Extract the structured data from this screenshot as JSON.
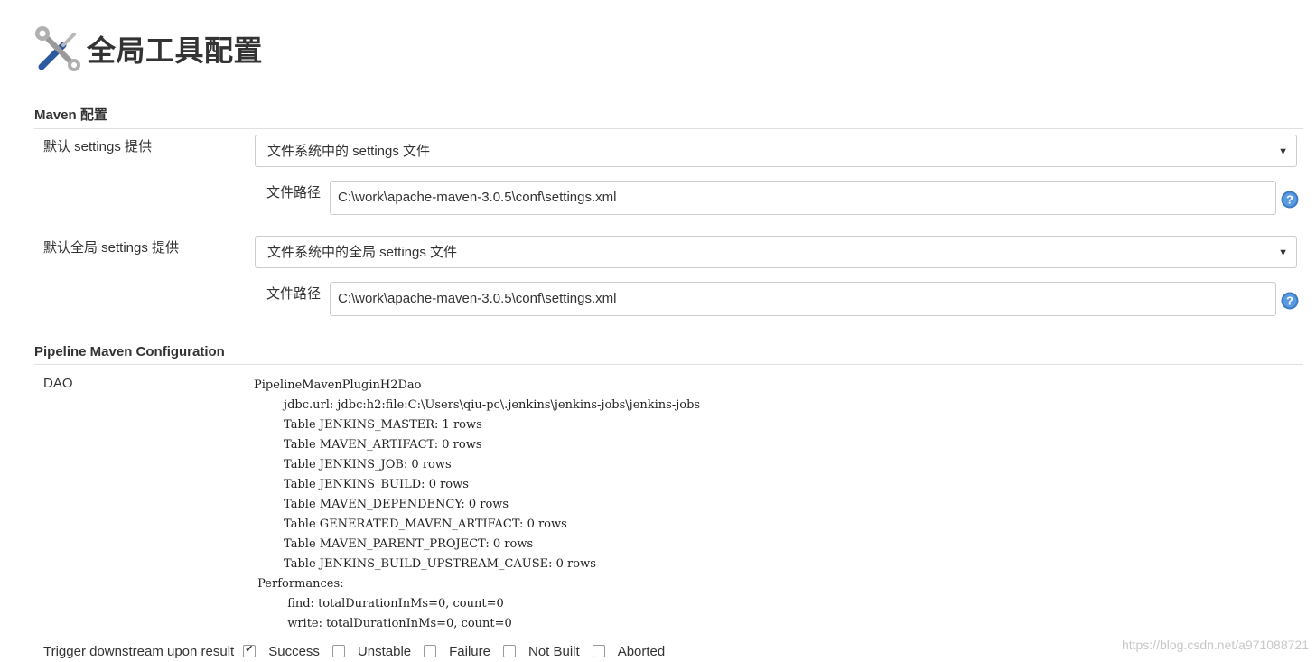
{
  "page": {
    "title": "全局工具配置",
    "icon": "tools-icon"
  },
  "maven_section": {
    "title": "Maven 配置",
    "settings": {
      "label": "默认 settings 提供",
      "selected": "文件系统中的 settings 文件",
      "path_label": "文件路径",
      "path_value": "C:\\work\\apache-maven-3.0.5\\conf\\settings.xml"
    },
    "global_settings": {
      "label": "默认全局 settings 提供",
      "selected": "文件系统中的全局 settings 文件",
      "path_label": "文件路径",
      "path_value": "C:\\work\\apache-maven-3.0.5\\conf\\settings.xml"
    }
  },
  "pipeline_section": {
    "title": "Pipeline Maven Configuration",
    "dao_label": "DAO",
    "dao_text": "PipelineMavenPluginH2Dao\n        jdbc.url: jdbc:h2:file:C:\\Users\\qiu-pc\\.jenkins\\jenkins-jobs\\jenkins-jobs\n        Table JENKINS_MASTER: 1 rows\n        Table MAVEN_ARTIFACT: 0 rows\n        Table JENKINS_JOB: 0 rows\n        Table JENKINS_BUILD: 0 rows\n        Table MAVEN_DEPENDENCY: 0 rows\n        Table GENERATED_MAVEN_ARTIFACT: 0 rows\n        Table MAVEN_PARENT_PROJECT: 0 rows\n        Table JENKINS_BUILD_UPSTREAM_CAUSE: 0 rows\n Performances:\n         find: totalDurationInMs=0, count=0\n         write: totalDurationInMs=0, count=0",
    "trigger_label": "Trigger downstream upon result",
    "trigger_options": [
      {
        "label": "Success",
        "checked": true
      },
      {
        "label": "Unstable",
        "checked": false
      },
      {
        "label": "Failure",
        "checked": false
      },
      {
        "label": "Not Built",
        "checked": false
      },
      {
        "label": "Aborted",
        "checked": false
      }
    ]
  },
  "watermark": "https://blog.csdn.net/a971088721",
  "colors": {
    "help_icon": "#3b7cc4",
    "border": "#cccccc"
  }
}
